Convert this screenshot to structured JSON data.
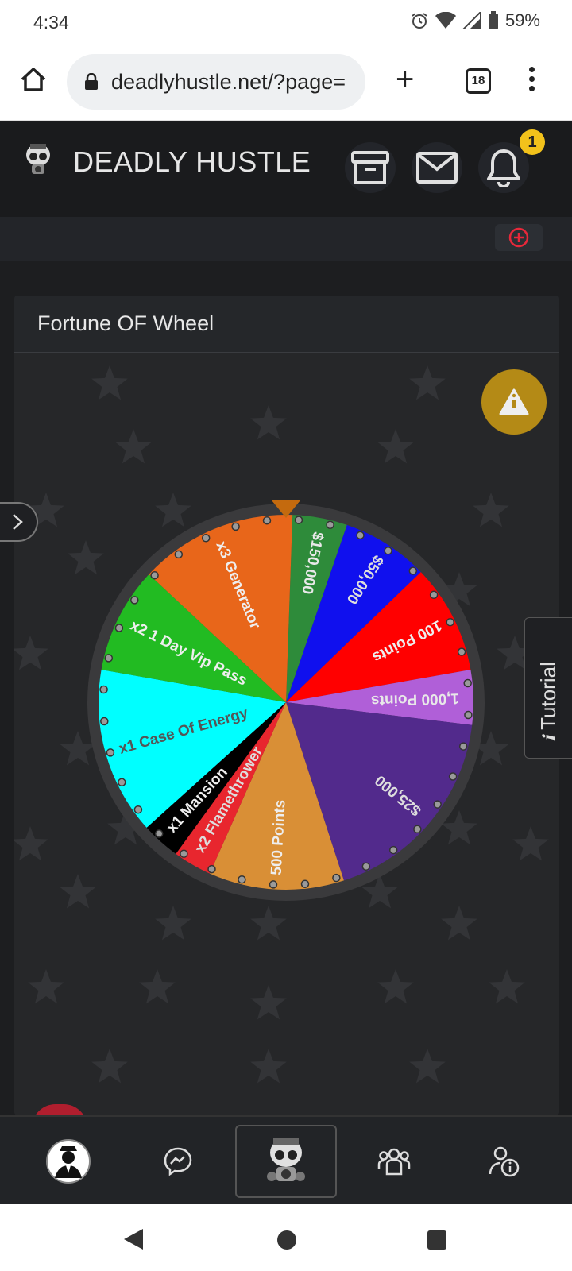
{
  "status": {
    "time": "4:34",
    "battery": "59%"
  },
  "browser": {
    "url": "deadlyhustle.net/?page=",
    "tab_count": "18"
  },
  "site": {
    "title": "DEADLY HUSTLE",
    "notification_count": "1"
  },
  "panel": {
    "title": "Fortune OF Wheel"
  },
  "tutorial": {
    "label": "Tutorial"
  },
  "wheel": {
    "segments": [
      {
        "label": "$150,000",
        "color": "#2e8b3a",
        "text_color": "#e8e8e8"
      },
      {
        "label": "$50,000",
        "color": "#1010ee",
        "text_color": "#dddddd"
      },
      {
        "label": "100 Points",
        "color": "#ff0000",
        "text_color": "#eeeeee"
      },
      {
        "label": "1,000 Points",
        "color": "#b05fd8",
        "text_color": "#e8e8e8"
      },
      {
        "label": "$25,000",
        "color": "#522a8c",
        "text_color": "#dddddd"
      },
      {
        "label": "500 Points",
        "color": "#d98f36",
        "text_color": "#eeeeee"
      },
      {
        "label": "x2 Flamethrower",
        "color": "#e8262e",
        "text_color": "#dddddd"
      },
      {
        "label": "x1 Mansion",
        "color": "#000000",
        "text_color": "#eeeeee"
      },
      {
        "label": "x1 Case Of Energy",
        "color": "#00ffff",
        "text_color": "#555555"
      },
      {
        "label": "x2 1 Day Vip Pass",
        "color": "#22bb22",
        "text_color": "#eeeeee"
      },
      {
        "label": "x3 Generator",
        "color": "#e8661a",
        "text_color": "#eeeeee"
      }
    ]
  },
  "nav": [
    "profile",
    "messenger",
    "home",
    "gang",
    "info"
  ],
  "colors": {
    "accent": "#b48a16",
    "badge": "#f2c21b",
    "bg": "#1d1e20"
  }
}
